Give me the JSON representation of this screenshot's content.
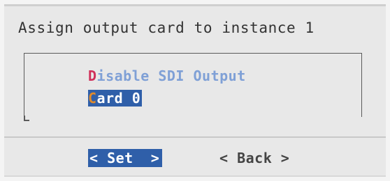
{
  "dialog": {
    "title": "Assign output card to instance 1"
  },
  "menu": {
    "items": [
      {
        "hotkey": "D",
        "rest": "isable SDI Output",
        "selected": false
      },
      {
        "hotkey": "C",
        "rest": "ard 0",
        "selected": true
      }
    ]
  },
  "buttons": {
    "set_label": "< Set  >",
    "back_label": "< Back >"
  },
  "colors": {
    "background": "#e8e8e8",
    "selection": "#2f5fa9",
    "hotkey": "#d0305a",
    "item_text": "#7fa0d6"
  }
}
